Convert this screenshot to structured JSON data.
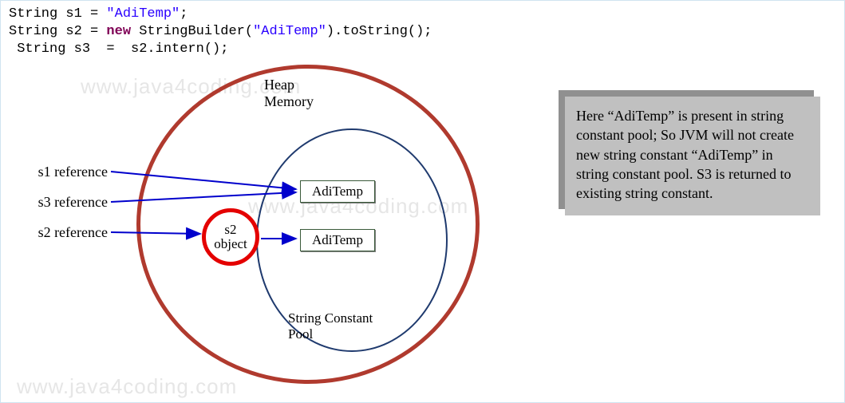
{
  "code": {
    "line1_pre": "String s1 = ",
    "line1_str": "\"AdiTemp\"",
    "line1_post": ";",
    "line2_pre": "String s2 = ",
    "line2_kw": "new",
    "line2_mid": " StringBuilder(",
    "line2_str": "\"AdiTemp\"",
    "line2_post": ").toString();",
    "line3": " String s3  =  s2.intern();"
  },
  "diagram": {
    "heap_label_l1": "Heap",
    "heap_label_l2": "Memory",
    "pool_label_l1": "String Constant",
    "pool_label_l2": "Pool",
    "s2_object_l1": "s2",
    "s2_object_l2": "object",
    "pool_item1": "AdiTemp",
    "pool_item2": "AdiTemp",
    "ref_s1": "s1 reference",
    "ref_s3": "s3 reference",
    "ref_s2": "s2 reference"
  },
  "explanation": "Here “AdiTemp” is present in string constant pool; So JVM will not create new string constant “AdiTemp” in string constant pool. S3 is returned to existing string constant.",
  "watermark": "www.java4coding.com"
}
